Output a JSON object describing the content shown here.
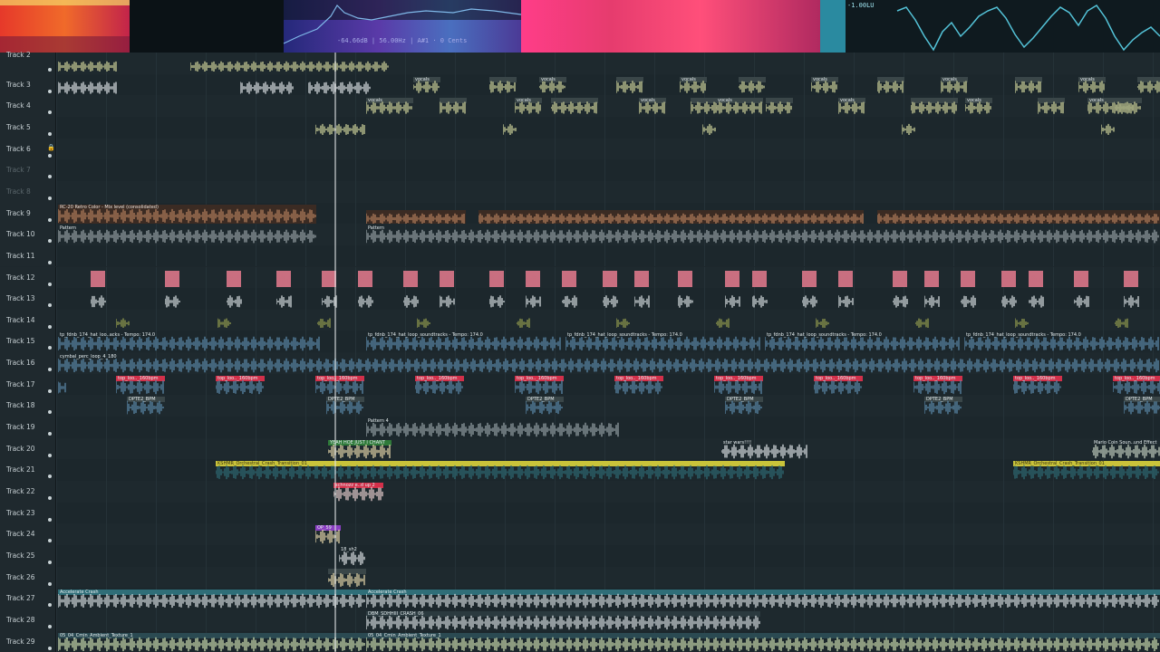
{
  "top_panel": {
    "readout": "-64.66dB | 56.00Hz | A#1 · 0 Cents",
    "lufs": "-1.00LU"
  },
  "tracks": [
    {
      "name": "Track 2",
      "clips": []
    },
    {
      "name": "Track 3",
      "clips": []
    },
    {
      "name": "Track 4",
      "clips": []
    },
    {
      "name": "Track 5",
      "clips": []
    },
    {
      "name": "Track 6",
      "clips": []
    },
    {
      "name": "Track 7",
      "clips": []
    },
    {
      "name": "Track 8",
      "clips": []
    },
    {
      "name": "Track 9",
      "clips": []
    },
    {
      "name": "Track 10",
      "clips": []
    },
    {
      "name": "Track 11",
      "clips": []
    },
    {
      "name": "Track 12",
      "clips": []
    },
    {
      "name": "Track 13",
      "clips": []
    },
    {
      "name": "Track 14",
      "clips": []
    },
    {
      "name": "Track 15",
      "clips": []
    },
    {
      "name": "Track 16",
      "clips": []
    },
    {
      "name": "Track 17",
      "clips": []
    },
    {
      "name": "Track 18",
      "clips": []
    },
    {
      "name": "Track 19",
      "clips": []
    },
    {
      "name": "Track 20",
      "clips": []
    },
    {
      "name": "Track 21",
      "clips": []
    },
    {
      "name": "Track 22",
      "clips": []
    },
    {
      "name": "Track 23",
      "clips": []
    },
    {
      "name": "Track 24",
      "clips": []
    },
    {
      "name": "Track 25",
      "clips": []
    },
    {
      "name": "Track 26",
      "clips": []
    },
    {
      "name": "Track 27",
      "clips": []
    },
    {
      "name": "Track 28",
      "clips": []
    },
    {
      "name": "Track 29",
      "clips": []
    }
  ],
  "clip_labels": {
    "vocals": "vocals",
    "retro": "RC-20 Retro Color - Mix level (consolidated)",
    "pattern": "Pattern",
    "pattern4": "Pattern 4",
    "hat": "tp_fdnb_174_hat_loop_soundtracks - Tempo: 174.0",
    "hat_short": "tp_fdnb_174_hat_loo..acks - Tempo: 174.0",
    "cymbal": "cymbal_perc_loop_4_180",
    "top": "top_loo.._160bpm",
    "dpte": "DPTE2_BPM",
    "chant": "YEAH HOE JUST I CHANT",
    "starwars": "star wars!!!!",
    "mario": "Mario Coin Soun..und Effect",
    "orch": "KSHMR_Orchestral_Crash_Transition_01",
    "schnoz": "schnozz e..d up 2",
    "op": "OP_59",
    "p18": "18_sh2",
    "accel": "Accelerate Crash",
    "dbm": "DBM_SDHHIII_CRASH_06",
    "ambient": "05_04_Cmin_Ambient_Texture_1"
  },
  "colors": {
    "vocal": "#d8dca0",
    "retro": "#b98360",
    "red": "#d2304a",
    "pink": "#c96f80",
    "blue": "#5e8eb0",
    "yellow": "#c9c33a",
    "teal": "#2f6e78",
    "purple": "#8a3fc2",
    "olive": "#9aa450",
    "cream": "#f0e0b0"
  }
}
